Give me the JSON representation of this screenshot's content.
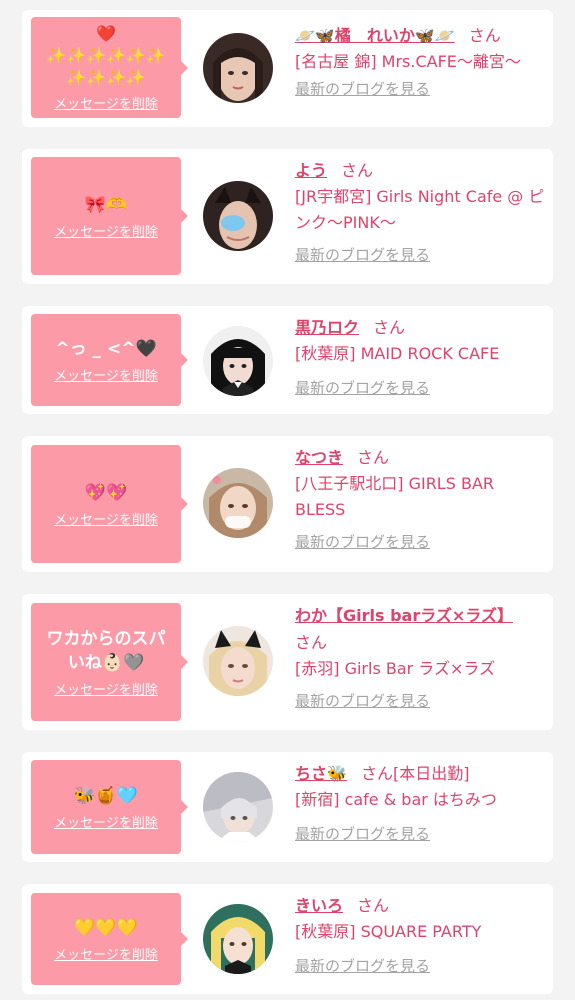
{
  "cards": [
    {
      "message": "❤️\n✨✨✨✨✨✨\n✨✨✨✨",
      "delete_label": "メッセージを削除",
      "name": "🦋橘　れいか🦋",
      "name_prefix": "🪐",
      "name_suffix": "🪐",
      "honorific": "さん",
      "tag": "",
      "shop": "[名古屋 錦] Mrs.CAFE〜離宮〜",
      "blog_label": "最新のブログを見る"
    },
    {
      "message": "🎀🫶",
      "delete_label": "メッセージを削除",
      "name": "よう",
      "honorific": "さん",
      "tag": "",
      "shop": "[JR宇都宮] Girls Night Cafe @ ピンク〜PINK〜",
      "blog_label": "最新のブログを見る"
    },
    {
      "message": "^っ _ <^🖤",
      "delete_label": "メッセージを削除",
      "name": "黒乃ロク",
      "honorific": "さん",
      "tag": "",
      "shop": "[秋葉原] MAID ROCK CAFE",
      "blog_label": "最新のブログを見る"
    },
    {
      "message": "💖💖",
      "delete_label": "メッセージを削除",
      "name": "なつき",
      "honorific": "さん",
      "tag": "",
      "shop": "[八王子駅北口] GIRLS BAR BLESS",
      "blog_label": "最新のブログを見る"
    },
    {
      "message": "ワカからのスパいね👶🏻🩶",
      "delete_label": "メッセージを削除",
      "name": "わか【Girls barラズ×ラズ】",
      "honorific": "さん",
      "tag": "",
      "shop": "[赤羽] Girls Bar ラズ×ラズ",
      "blog_label": "最新のブログを見る"
    },
    {
      "message": "🐝🍯🩵",
      "delete_label": "メッセージを削除",
      "name": "ちさ🐝",
      "honorific": "さん",
      "tag": "[本日出勤]",
      "shop": "[新宿] cafe & bar はちみつ",
      "blog_label": "最新のブログを見る"
    },
    {
      "message": "💛💛💛",
      "delete_label": "メッセージを削除",
      "name": "きいろ",
      "honorific": "さん",
      "tag": "",
      "shop": "[秋葉原] SQUARE PARTY",
      "blog_label": "最新のブログを見る"
    }
  ],
  "colors": {
    "accent": "#e0436a",
    "bubble": "#fc9aa8",
    "muted": "#a3a3a3",
    "background": "#f3f3f3"
  }
}
